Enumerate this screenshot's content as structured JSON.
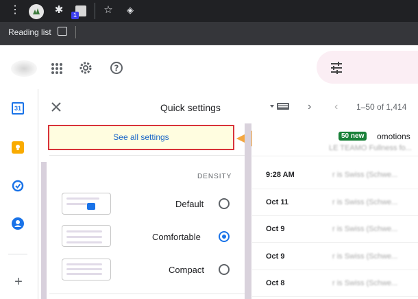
{
  "browser": {
    "menu_icon": "more-vert-icon",
    "bookmark_label": "Reading list",
    "extension_badge": "1"
  },
  "quick_settings": {
    "title": "Quick settings",
    "see_all": "See all settings",
    "density_heading": "DENSITY",
    "options": [
      {
        "label": "Default",
        "selected": false
      },
      {
        "label": "Comfortable",
        "selected": true
      },
      {
        "label": "Compact",
        "selected": false
      }
    ]
  },
  "mail": {
    "pagination": "1–50 of 1,414",
    "promotions_label": "omotions",
    "new_badge": "50 new",
    "rows": [
      {
        "time": "9:28 AM",
        "snippet": "r is Swiss (Schwe..."
      },
      {
        "time": "Oct 11",
        "snippet": "r is Swiss (Schwe..."
      },
      {
        "time": "Oct 9",
        "snippet": "r is Swiss (Schwe..."
      },
      {
        "time": "Oct 9",
        "snippet": "r is Swiss (Schwe..."
      },
      {
        "time": "Oct 8",
        "snippet": "r is Swiss (Schwe..."
      }
    ],
    "promo_snippet": "LE TEAMO Fullness fo..."
  },
  "colors": {
    "accent_red": "#d8323a",
    "arrow": "#f4a740",
    "badge_green": "#188038",
    "link_blue": "#1a66c8"
  }
}
